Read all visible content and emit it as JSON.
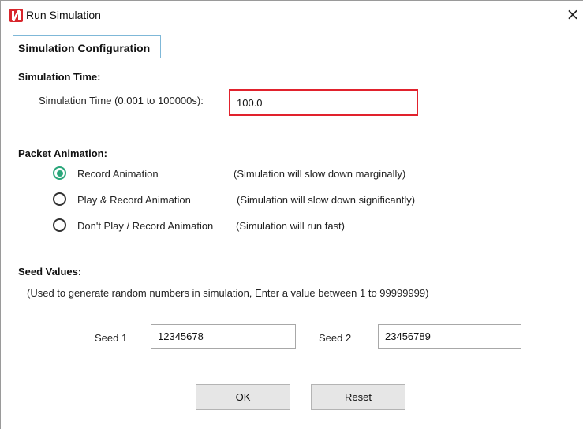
{
  "window": {
    "title": "Run Simulation",
    "icon": "netsim-logo-icon",
    "close_icon": "×"
  },
  "tabs": [
    {
      "label": "Simulation Configuration",
      "active": true
    }
  ],
  "simulation_time": {
    "section_title": "Simulation Time:",
    "label": "Simulation Time (0.001 to 100000s):",
    "value": "100.0"
  },
  "packet_animation": {
    "section_title": "Packet Animation:",
    "options": [
      {
        "label": "Record Animation",
        "note": "(Simulation will slow down marginally)",
        "selected": true
      },
      {
        "label": "Play & Record Animation",
        "note": "(Simulation will slow down significantly)",
        "selected": false
      },
      {
        "label": "Don't Play / Record Animation",
        "note": "(Simulation will run fast)",
        "selected": false
      }
    ]
  },
  "seed_values": {
    "section_title": "Seed Values:",
    "description": "(Used to generate random numbers in simulation, Enter a value between 1 to 99999999)",
    "seed1_label": "Seed 1",
    "seed1_value": "12345678",
    "seed2_label": "Seed 2",
    "seed2_value": "23456789"
  },
  "buttons": {
    "ok_label": "OK",
    "reset_label": "Reset"
  },
  "colors": {
    "highlight_border": "#e1222d",
    "radio_selected": "#2aa67a",
    "tab_border": "#7fb8d8"
  }
}
